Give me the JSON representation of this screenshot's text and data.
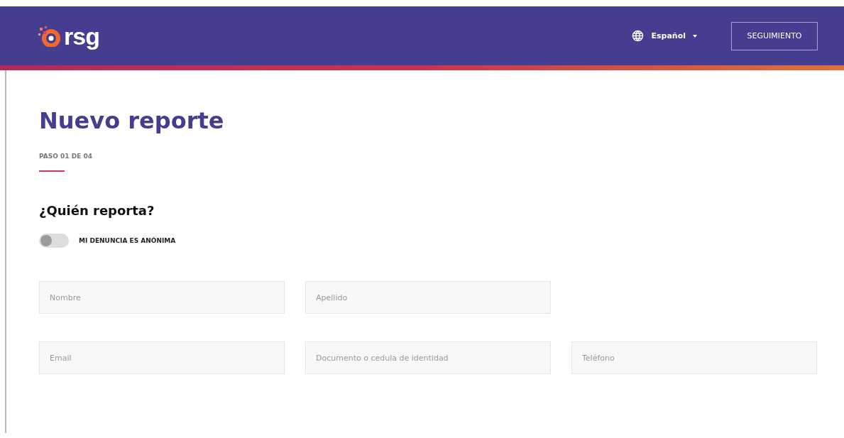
{
  "header": {
    "logo": "rsg",
    "language": "Español",
    "track_button": "SEGUIMIENTO"
  },
  "title": "Nuevo reporte",
  "step": "PASO 01 DE 04",
  "section": "¿Quién reporta?",
  "anonymous": {
    "label": "MI DENUNCIA ES ANÓNIMA",
    "on": false
  },
  "field_rows": [
    [
      {
        "placeholder": "Nombre"
      },
      {
        "placeholder": "Apellido"
      }
    ],
    [
      {
        "placeholder": "Email"
      },
      {
        "placeholder": "Documento o cedula de identidad"
      },
      {
        "placeholder": "Teléfono"
      }
    ]
  ]
}
